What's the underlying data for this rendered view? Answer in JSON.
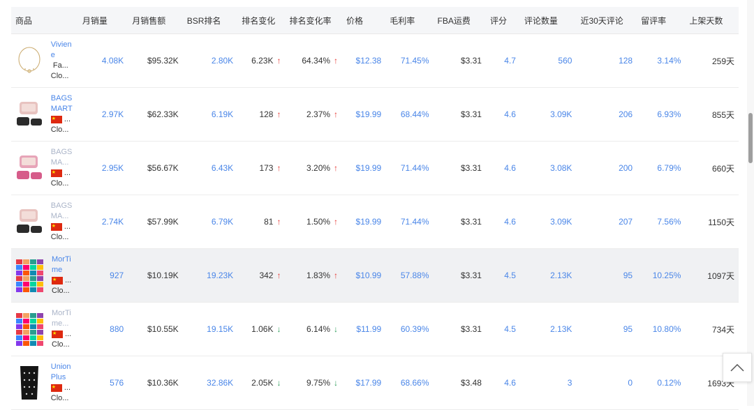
{
  "headers": [
    "商品",
    "月销量",
    "月销售额",
    "BSR排名",
    "排名变化",
    "排名变化率",
    "价格",
    "毛利率",
    "FBA运费",
    "评分",
    "评论数量",
    "近30天评论",
    "留评率",
    "上架天数"
  ],
  "rows": [
    {
      "name": "Viviene",
      "muted": false,
      "flag": false,
      "sub": "Fa...",
      "sub2": "Clo...",
      "thumb": "necklace-thumbnail",
      "sales": "4.08K",
      "revenue": "$95.32K",
      "bsr": "2.80K",
      "rank_change": "6.23K",
      "rank_dir": "up",
      "rank_rate": "64.34%",
      "rate_dir": "up",
      "price": "$12.38",
      "margin": "71.45%",
      "fba": "$3.31",
      "rating": "4.7",
      "reviews": "560",
      "reviews30": "128",
      "review_rate": "3.14%",
      "days": "259天"
    },
    {
      "name": "BAGSMART",
      "muted": false,
      "flag": true,
      "sub": "...",
      "sub2": "Clo...",
      "thumb": "bag-pink-thumbnail",
      "sales": "2.97K",
      "revenue": "$62.33K",
      "bsr": "6.19K",
      "rank_change": "128",
      "rank_dir": "up",
      "rank_rate": "2.37%",
      "rate_dir": "up",
      "price": "$19.99",
      "margin": "68.44%",
      "fba": "$3.31",
      "rating": "4.6",
      "reviews": "3.09K",
      "reviews30": "206",
      "review_rate": "6.93%",
      "days": "855天"
    },
    {
      "name": "BAGSMA...",
      "muted": true,
      "flag": true,
      "sub": "...",
      "sub2": "Clo...",
      "thumb": "bag-rose-thumbnail",
      "sales": "2.95K",
      "revenue": "$56.67K",
      "bsr": "6.43K",
      "rank_change": "173",
      "rank_dir": "up",
      "rank_rate": "3.20%",
      "rate_dir": "up",
      "price": "$19.99",
      "margin": "71.44%",
      "fba": "$3.31",
      "rating": "4.6",
      "reviews": "3.08K",
      "reviews30": "200",
      "review_rate": "6.79%",
      "days": "660天"
    },
    {
      "name": "BAGSMA...",
      "muted": true,
      "flag": true,
      "sub": "...",
      "sub2": "Clo...",
      "thumb": "bag-pink-thumbnail",
      "sales": "2.74K",
      "revenue": "$57.99K",
      "bsr": "6.79K",
      "rank_change": "81",
      "rank_dir": "up",
      "rank_rate": "1.50%",
      "rate_dir": "up",
      "price": "$19.99",
      "margin": "71.44%",
      "fba": "$3.31",
      "rating": "4.6",
      "reviews": "3.09K",
      "reviews30": "207",
      "review_rate": "7.56%",
      "days": "1150天"
    },
    {
      "name": "MorTime",
      "muted": false,
      "flag": true,
      "sub": "...",
      "sub2": "Clo...",
      "thumb": "pouch-grid-thumbnail",
      "sales": "927",
      "revenue": "$10.19K",
      "bsr": "19.23K",
      "rank_change": "342",
      "rank_dir": "up",
      "rank_rate": "1.83%",
      "rate_dir": "up",
      "price": "$10.99",
      "margin": "57.88%",
      "fba": "$3.31",
      "rating": "4.5",
      "reviews": "2.13K",
      "reviews30": "95",
      "review_rate": "10.25%",
      "days": "1097天",
      "highlight": true
    },
    {
      "name": "MorTime...",
      "muted": true,
      "flag": true,
      "sub": "...",
      "sub2": "Clo...",
      "thumb": "pouch-grid-thumbnail",
      "sales": "880",
      "revenue": "$10.55K",
      "bsr": "19.15K",
      "rank_change": "1.06K",
      "rank_dir": "down",
      "rank_rate": "6.14%",
      "rate_dir": "down",
      "price": "$11.99",
      "margin": "60.39%",
      "fba": "$3.31",
      "rating": "4.5",
      "reviews": "2.13K",
      "reviews30": "95",
      "review_rate": "10.80%",
      "days": "734天"
    },
    {
      "name": "UnionPlus",
      "muted": false,
      "flag": true,
      "sub": "...",
      "sub2": "Clo...",
      "thumb": "jewelry-board-thumbnail",
      "sales": "576",
      "revenue": "$10.36K",
      "bsr": "32.86K",
      "rank_change": "2.05K",
      "rank_dir": "down",
      "rank_rate": "9.75%",
      "rate_dir": "down",
      "price": "$17.99",
      "margin": "68.66%",
      "fba": "$3.48",
      "rating": "4.6",
      "reviews": "3",
      "reviews30": "0",
      "review_rate": "0.12%",
      "days": "1693天"
    }
  ],
  "icons": {
    "up": "↑",
    "down": "↓",
    "back_top": "chevron-up-icon"
  },
  "colors": {
    "link": "#4a86e8",
    "up": "#e53935",
    "down": "#2e9e5b"
  }
}
